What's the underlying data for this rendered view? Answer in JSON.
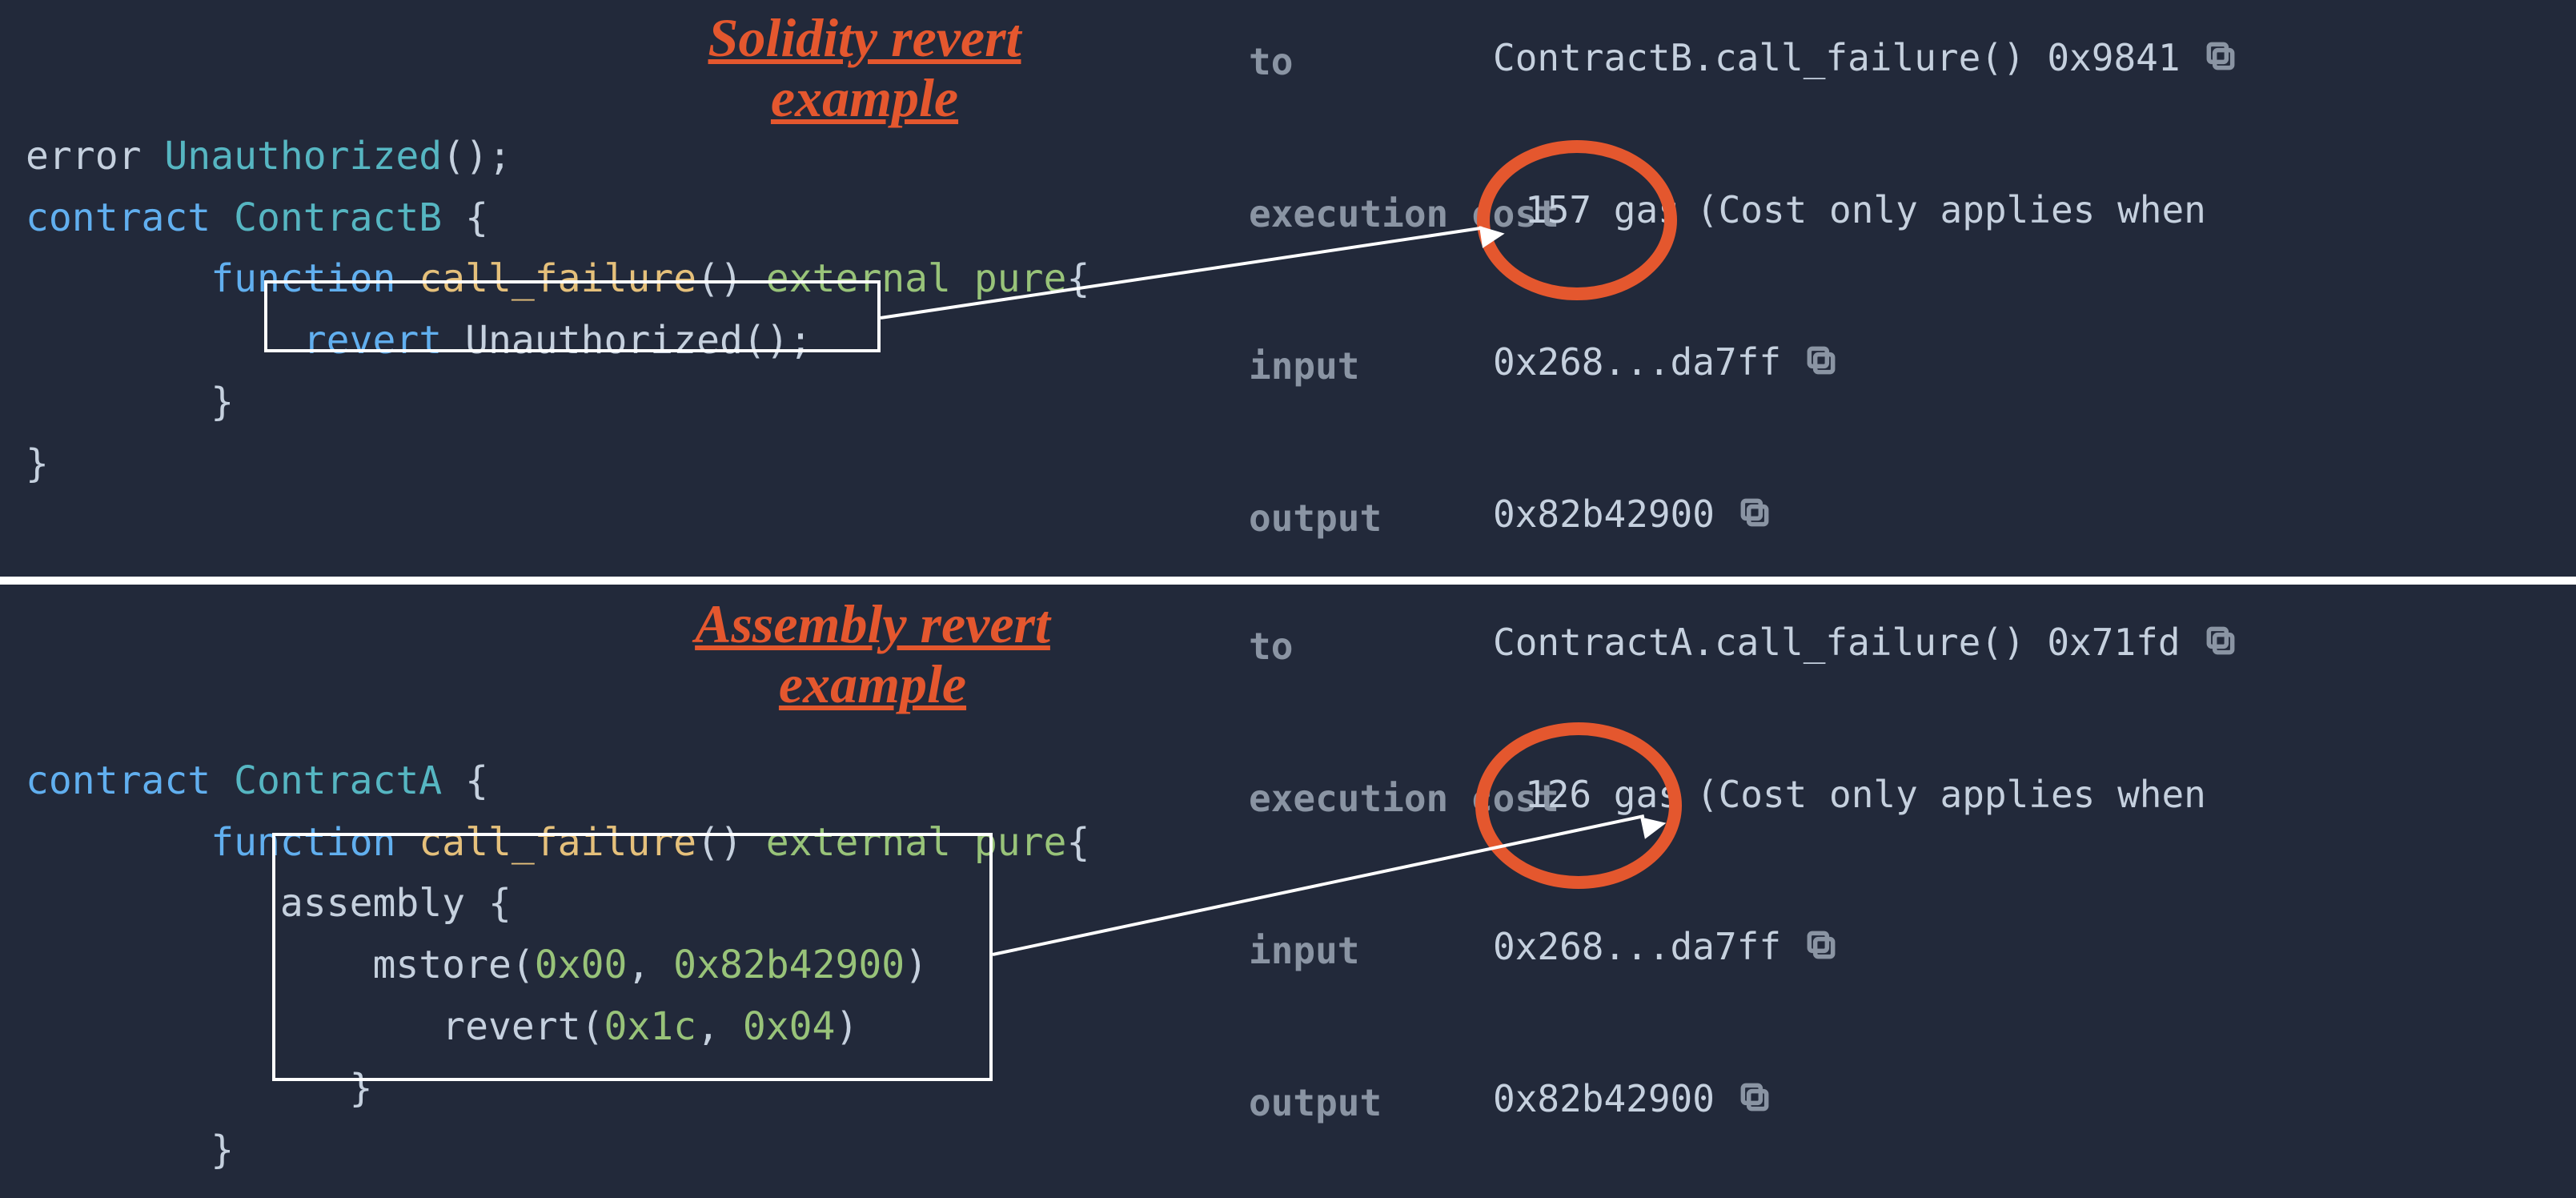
{
  "top": {
    "title_l1": "Solidity revert",
    "title_l2": "example",
    "code_l1_a": "error ",
    "code_l1_b": "Unauthorized",
    "code_l1_c": "();",
    "code_l2_a": "contract ",
    "code_l2_b": "ContractB ",
    "code_l2_c": "{",
    "code_l3_a": "function ",
    "code_l3_b": "call_failure",
    "code_l3_c": "() ",
    "code_l3_d": "external ",
    "code_l3_e": "pure",
    "code_l3_f": "{",
    "code_l4_a": "revert ",
    "code_l4_b": "Unauthorized();",
    "code_l5": "}",
    "code_l6": "}",
    "labels": {
      "to": "to",
      "exec": "execution cost",
      "input": "input",
      "output": "output"
    },
    "vals": {
      "to": "ContractB.call_failure() 0x9841",
      "exec_pre": "157 gas",
      "exec_post": " (Cost only applies when",
      "input": "0x268...da7ff",
      "output": "0x82b42900"
    }
  },
  "bottom": {
    "title_l1": "Assembly revert",
    "title_l2": "example",
    "code_l1_a": "contract ",
    "code_l1_b": "ContractA ",
    "code_l1_c": "{",
    "code_l2_a": "function ",
    "code_l2_b": "call_failure",
    "code_l2_c": "() ",
    "code_l2_d": "external ",
    "code_l2_e": "pure",
    "code_l2_f": "{",
    "code_l3": "assembly {",
    "code_l4_a": "mstore(",
    "code_l4_b": "0x00",
    "code_l4_c": ", ",
    "code_l4_d": "0x82b42900",
    "code_l4_e": ")",
    "code_l5_a": "revert(",
    "code_l5_b": "0x1c",
    "code_l5_c": ", ",
    "code_l5_d": "0x04",
    "code_l5_e": ")",
    "code_l6": "}",
    "code_l7": "}",
    "labels": {
      "to": "to",
      "exec": "execution cost",
      "input": "input",
      "output": "output"
    },
    "vals": {
      "to": "ContractA.call_failure() 0x71fd",
      "exec_pre": "126 gas",
      "exec_post": " (Cost only applies when",
      "input": "0x268...da7ff",
      "output": "0x82b42900"
    }
  }
}
